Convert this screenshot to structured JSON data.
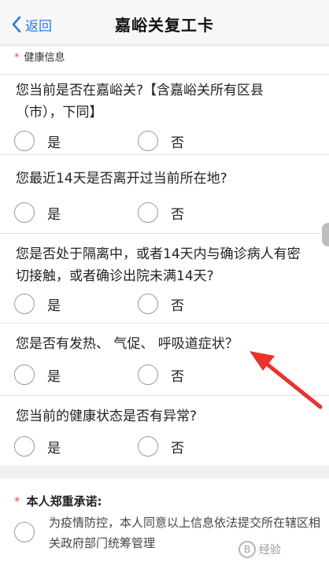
{
  "nav": {
    "back_label": "返回",
    "title": "嘉峪关复工卡"
  },
  "health": {
    "section_label": "健康信息",
    "required_mark": "*",
    "questions": [
      {
        "text": "您当前是否在嘉峪关?【含嘉峪关所有区县（市），下同】",
        "yes": "是",
        "no": "否"
      },
      {
        "text": "您最近14天是否离开过当前所在地?",
        "yes": "是",
        "no": "否"
      },
      {
        "text": "您是否处于隔离中，或者14天内与确诊病人有密切接触，或者确诊出院未满14天?",
        "yes": "是",
        "no": "否"
      },
      {
        "text": "您是否有发热、 气促、 呼吸道症状？",
        "yes": "是",
        "no": "否"
      },
      {
        "text": "您当前的健康状态是否有异常?",
        "yes": "是",
        "no": "否"
      }
    ]
  },
  "promise": {
    "required_mark": "*",
    "title": "本人郑重承诺:",
    "text": "为疫情防控，本人同意以上信息依法提交所在辖区相关政府部门统筹管理"
  },
  "watermark": {
    "badge": "B",
    "text": "经验"
  },
  "colors": {
    "accent": "#2a7ae2",
    "required": "#e0503a",
    "arrow": "#e8322c"
  }
}
